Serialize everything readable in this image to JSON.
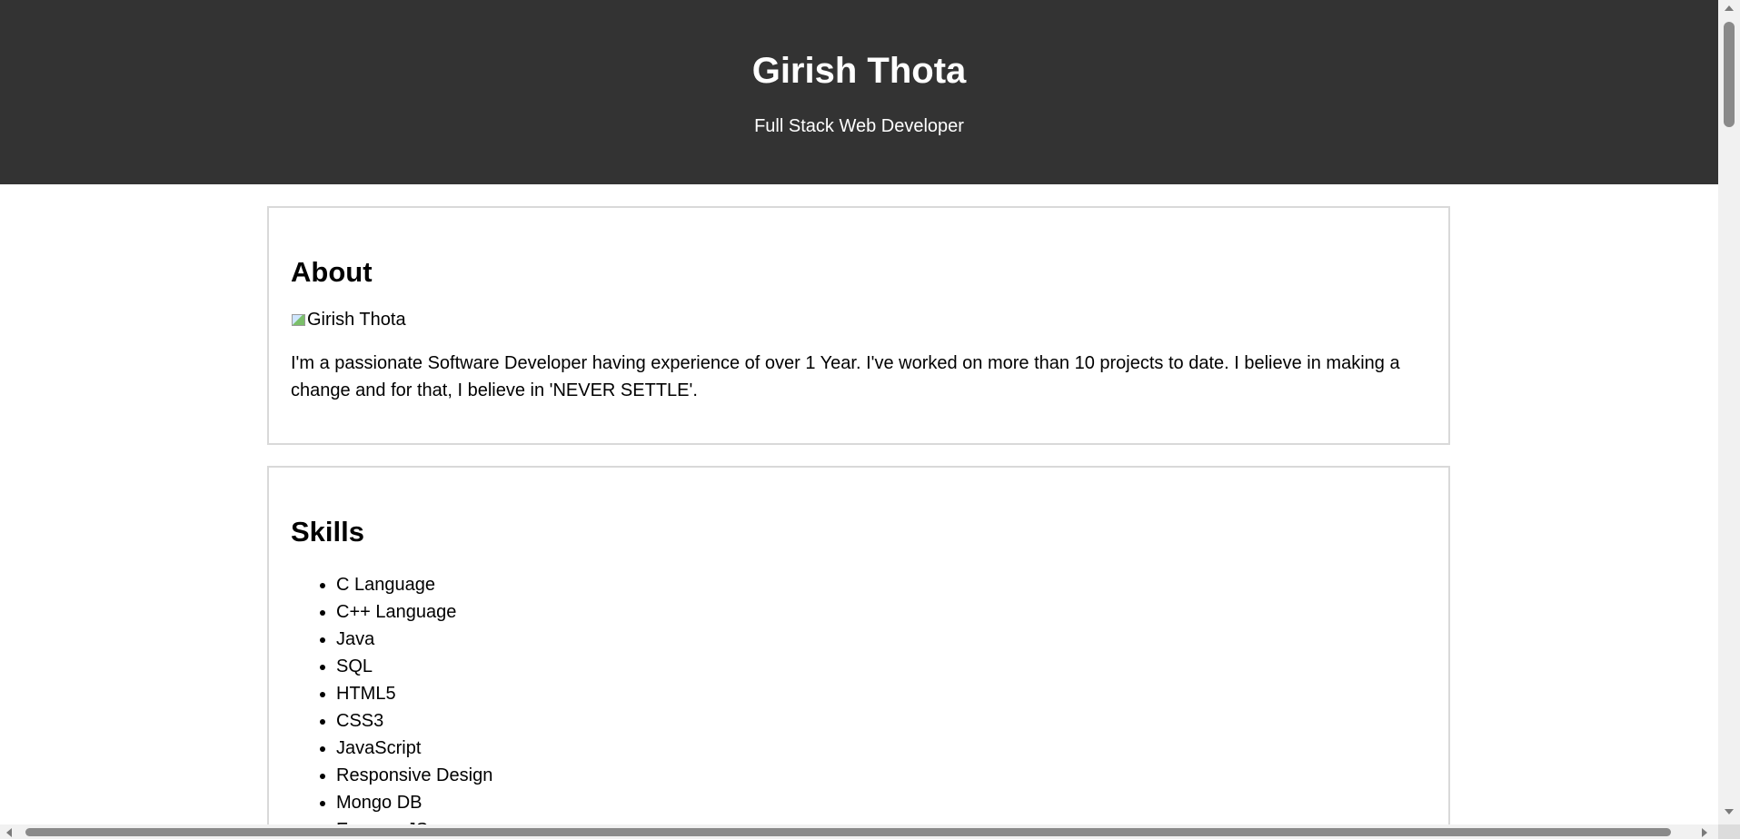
{
  "header": {
    "title": "Girish Thota",
    "subtitle": "Full Stack Web Developer",
    "background_color": "#333333",
    "text_color": "#ffffff"
  },
  "about": {
    "heading": "About",
    "image_alt": "Girish Thota",
    "text": "I'm a passionate Software Developer having experience of over 1 Year. I've worked on more than 10 projects to date. I believe in making a change and for that, I believe in 'NEVER SETTLE'."
  },
  "skills": {
    "heading": "Skills",
    "items": [
      "C Language",
      "C++ Language",
      "Java",
      "SQL",
      "HTML5",
      "CSS3",
      "JavaScript",
      "Responsive Design",
      "Mongo DB",
      "Express JS"
    ]
  },
  "icons": {
    "broken_image": "broken-image-icon",
    "scroll_up": "arrow-up-icon",
    "scroll_down": "arrow-down-icon",
    "scroll_left": "arrow-left-icon",
    "scroll_right": "arrow-right-icon"
  }
}
